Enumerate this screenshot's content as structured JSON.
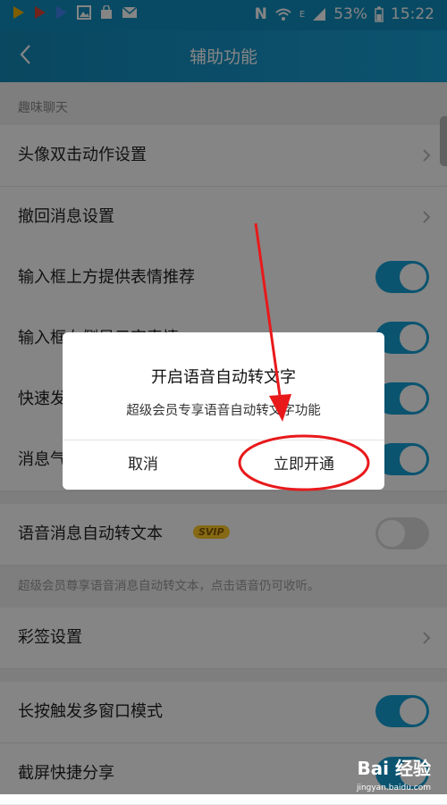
{
  "status_bar": {
    "battery": "53%",
    "time": "15:22",
    "network_letter": "N",
    "signal_letter": "E"
  },
  "nav": {
    "title": "辅助功能"
  },
  "sections": {
    "fun_chat": "趣味聊天"
  },
  "rows": [
    {
      "label": "头像双击动作设置",
      "control": "chevron"
    },
    {
      "label": "撤回消息设置",
      "control": "chevron"
    },
    {
      "label": "输入框上方提供表情推荐",
      "control": "toggle",
      "on": true
    },
    {
      "label": "输入框右侧显示字表情",
      "control": "toggle",
      "on": true
    },
    {
      "label": "快速发",
      "control": "toggle",
      "on": true
    },
    {
      "label": "消息气",
      "control": "toggle",
      "on": true
    },
    {
      "label": "语音消息自动转文本",
      "control": "toggle",
      "on": false,
      "badge": "SVIP"
    },
    {
      "label": "彩签设置",
      "control": "chevron"
    },
    {
      "label": "长按触发多窗口模式",
      "control": "toggle",
      "on": true
    },
    {
      "label": "截屏快捷分享",
      "control": "toggle",
      "on": true
    }
  ],
  "voice_note": "超级会员尊享语音消息自动转文本，点击语音仍可收听。",
  "dialog": {
    "title": "开启语音自动转文字",
    "message": "超级会员专享语音自动转文字功能",
    "cancel_label": "取消",
    "confirm_label": "立即开通"
  },
  "watermark": {
    "brand": "Bai 经验",
    "url": "jingyan.baidu.com"
  },
  "colors": {
    "accent": "#16a2d6",
    "annotation": "#e8191b"
  },
  "icons": {
    "back": "back-arrow-icon",
    "chevron": "chevron-right-icon"
  }
}
